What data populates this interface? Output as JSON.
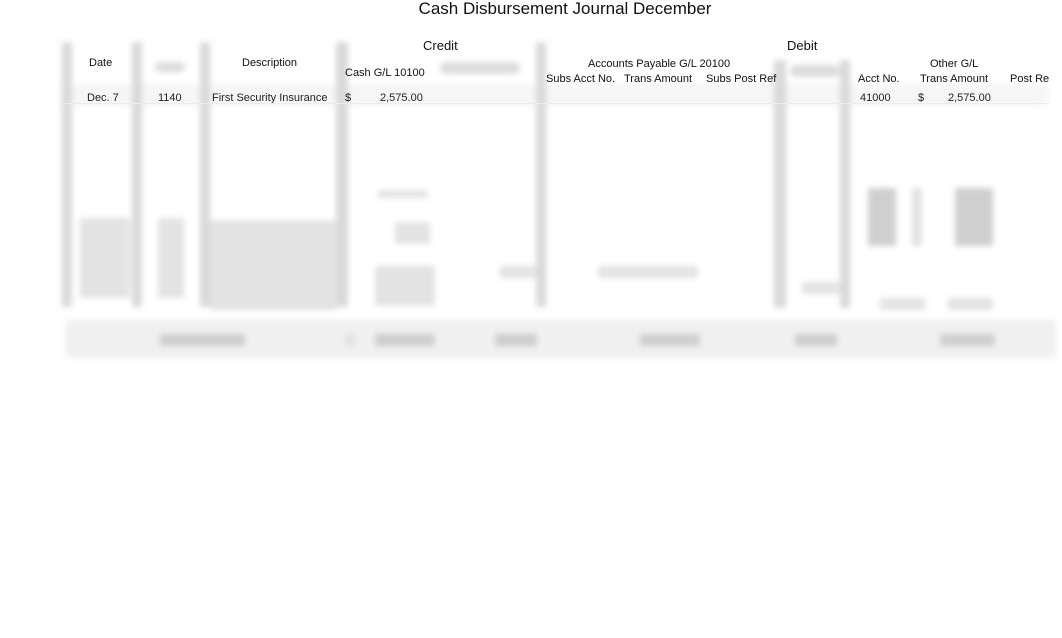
{
  "document": {
    "title": "Cash Disbursement Journal December"
  },
  "header": {
    "groups": {
      "credit": "Credit",
      "debit": "Debit",
      "accounts_payable": "Accounts Payable G/L 20100",
      "other_gl": "Other G/L"
    },
    "columns": {
      "date": "Date",
      "description": "Description",
      "cash": "Cash G/L 10100",
      "ap_subs_acct_no": "Subs Acct No.",
      "ap_trans_amount": "Trans Amount",
      "ap_subs_post_ref": "Subs Post Ref",
      "other_acct_no": "Acct No.",
      "other_trans_amount": "Trans Amount",
      "other_post_ref": "Post Re"
    }
  },
  "rows": [
    {
      "date": "Dec. 7",
      "check_no": "1140",
      "description": "First Security Insurance",
      "cash_currency": "$",
      "cash_amount": "2,575.00",
      "other_acct_no": "41000",
      "other_currency": "$",
      "other_amount": "2,575.00"
    }
  ],
  "preview": {
    "blurred": true
  }
}
